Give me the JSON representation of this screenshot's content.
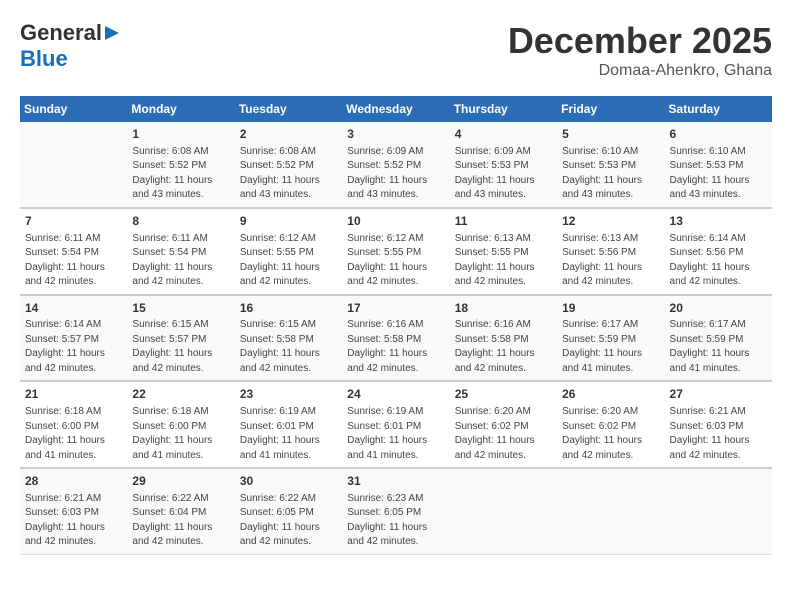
{
  "logo": {
    "line1": "General",
    "line2": "Blue"
  },
  "title": "December 2025",
  "subtitle": "Domaa-Ahenkro, Ghana",
  "headers": [
    "Sunday",
    "Monday",
    "Tuesday",
    "Wednesday",
    "Thursday",
    "Friday",
    "Saturday"
  ],
  "weeks": [
    [
      {
        "day": "",
        "info": ""
      },
      {
        "day": "1",
        "info": "Sunrise: 6:08 AM\nSunset: 5:52 PM\nDaylight: 11 hours\nand 43 minutes."
      },
      {
        "day": "2",
        "info": "Sunrise: 6:08 AM\nSunset: 5:52 PM\nDaylight: 11 hours\nand 43 minutes."
      },
      {
        "day": "3",
        "info": "Sunrise: 6:09 AM\nSunset: 5:52 PM\nDaylight: 11 hours\nand 43 minutes."
      },
      {
        "day": "4",
        "info": "Sunrise: 6:09 AM\nSunset: 5:53 PM\nDaylight: 11 hours\nand 43 minutes."
      },
      {
        "day": "5",
        "info": "Sunrise: 6:10 AM\nSunset: 5:53 PM\nDaylight: 11 hours\nand 43 minutes."
      },
      {
        "day": "6",
        "info": "Sunrise: 6:10 AM\nSunset: 5:53 PM\nDaylight: 11 hours\nand 43 minutes."
      }
    ],
    [
      {
        "day": "7",
        "info": "Sunrise: 6:11 AM\nSunset: 5:54 PM\nDaylight: 11 hours\nand 42 minutes."
      },
      {
        "day": "8",
        "info": "Sunrise: 6:11 AM\nSunset: 5:54 PM\nDaylight: 11 hours\nand 42 minutes."
      },
      {
        "day": "9",
        "info": "Sunrise: 6:12 AM\nSunset: 5:55 PM\nDaylight: 11 hours\nand 42 minutes."
      },
      {
        "day": "10",
        "info": "Sunrise: 6:12 AM\nSunset: 5:55 PM\nDaylight: 11 hours\nand 42 minutes."
      },
      {
        "day": "11",
        "info": "Sunrise: 6:13 AM\nSunset: 5:55 PM\nDaylight: 11 hours\nand 42 minutes."
      },
      {
        "day": "12",
        "info": "Sunrise: 6:13 AM\nSunset: 5:56 PM\nDaylight: 11 hours\nand 42 minutes."
      },
      {
        "day": "13",
        "info": "Sunrise: 6:14 AM\nSunset: 5:56 PM\nDaylight: 11 hours\nand 42 minutes."
      }
    ],
    [
      {
        "day": "14",
        "info": "Sunrise: 6:14 AM\nSunset: 5:57 PM\nDaylight: 11 hours\nand 42 minutes."
      },
      {
        "day": "15",
        "info": "Sunrise: 6:15 AM\nSunset: 5:57 PM\nDaylight: 11 hours\nand 42 minutes."
      },
      {
        "day": "16",
        "info": "Sunrise: 6:15 AM\nSunset: 5:58 PM\nDaylight: 11 hours\nand 42 minutes."
      },
      {
        "day": "17",
        "info": "Sunrise: 6:16 AM\nSunset: 5:58 PM\nDaylight: 11 hours\nand 42 minutes."
      },
      {
        "day": "18",
        "info": "Sunrise: 6:16 AM\nSunset: 5:58 PM\nDaylight: 11 hours\nand 42 minutes."
      },
      {
        "day": "19",
        "info": "Sunrise: 6:17 AM\nSunset: 5:59 PM\nDaylight: 11 hours\nand 41 minutes."
      },
      {
        "day": "20",
        "info": "Sunrise: 6:17 AM\nSunset: 5:59 PM\nDaylight: 11 hours\nand 41 minutes."
      }
    ],
    [
      {
        "day": "21",
        "info": "Sunrise: 6:18 AM\nSunset: 6:00 PM\nDaylight: 11 hours\nand 41 minutes."
      },
      {
        "day": "22",
        "info": "Sunrise: 6:18 AM\nSunset: 6:00 PM\nDaylight: 11 hours\nand 41 minutes."
      },
      {
        "day": "23",
        "info": "Sunrise: 6:19 AM\nSunset: 6:01 PM\nDaylight: 11 hours\nand 41 minutes."
      },
      {
        "day": "24",
        "info": "Sunrise: 6:19 AM\nSunset: 6:01 PM\nDaylight: 11 hours\nand 41 minutes."
      },
      {
        "day": "25",
        "info": "Sunrise: 6:20 AM\nSunset: 6:02 PM\nDaylight: 11 hours\nand 42 minutes."
      },
      {
        "day": "26",
        "info": "Sunrise: 6:20 AM\nSunset: 6:02 PM\nDaylight: 11 hours\nand 42 minutes."
      },
      {
        "day": "27",
        "info": "Sunrise: 6:21 AM\nSunset: 6:03 PM\nDaylight: 11 hours\nand 42 minutes."
      }
    ],
    [
      {
        "day": "28",
        "info": "Sunrise: 6:21 AM\nSunset: 6:03 PM\nDaylight: 11 hours\nand 42 minutes."
      },
      {
        "day": "29",
        "info": "Sunrise: 6:22 AM\nSunset: 6:04 PM\nDaylight: 11 hours\nand 42 minutes."
      },
      {
        "day": "30",
        "info": "Sunrise: 6:22 AM\nSunset: 6:05 PM\nDaylight: 11 hours\nand 42 minutes."
      },
      {
        "day": "31",
        "info": "Sunrise: 6:23 AM\nSunset: 6:05 PM\nDaylight: 11 hours\nand 42 minutes."
      },
      {
        "day": "",
        "info": ""
      },
      {
        "day": "",
        "info": ""
      },
      {
        "day": "",
        "info": ""
      }
    ]
  ]
}
